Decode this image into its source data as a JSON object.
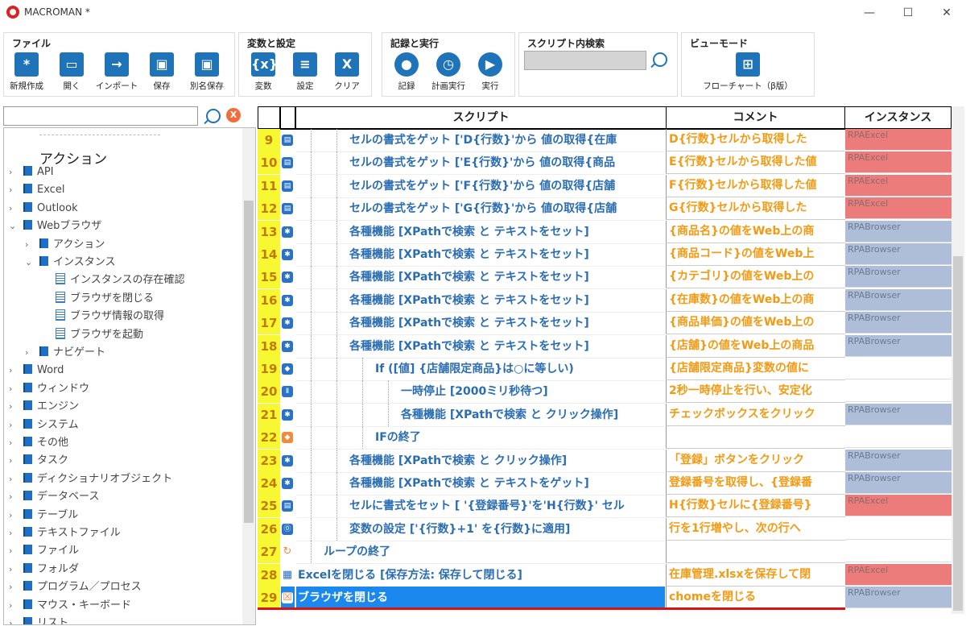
{
  "window": {
    "title": "MACROMAN *",
    "minimize": "—",
    "maximize": "☐",
    "close": "✕"
  },
  "ribbon": {
    "file": {
      "title": "ファイル",
      "buttons": [
        {
          "label": "新規作成",
          "icon": "*"
        },
        {
          "label": "開く",
          "icon": "▭"
        },
        {
          "label": "インポート",
          "icon": "→"
        },
        {
          "label": "保存",
          "icon": "▣"
        },
        {
          "label": "別名保存",
          "icon": "▣"
        }
      ]
    },
    "vars": {
      "title": "変数と設定",
      "buttons": [
        {
          "label": "変数",
          "icon": "{x}"
        },
        {
          "label": "設定",
          "icon": "≡"
        },
        {
          "label": "クリア",
          "icon": "X"
        }
      ]
    },
    "rec": {
      "title": "記録と実行",
      "buttons": [
        {
          "label": "記録",
          "icon": "●"
        },
        {
          "label": "計画実行",
          "icon": "◷"
        },
        {
          "label": "実行",
          "icon": "▶"
        }
      ]
    },
    "search": {
      "title": "スクリプト内検索",
      "value": ""
    },
    "view": {
      "title": "ビューモード",
      "buttons": [
        {
          "label": "フローチャート（β版）",
          "icon": "⊞"
        }
      ]
    }
  },
  "sidebar": {
    "search_value": "",
    "clear_label": "X",
    "heading": "アクション",
    "items": [
      {
        "label": "API",
        "arrow": "›",
        "type": "book",
        "indent": 0
      },
      {
        "label": "Excel",
        "arrow": "›",
        "type": "book",
        "indent": 0
      },
      {
        "label": "Outlook",
        "arrow": "›",
        "type": "book",
        "indent": 0
      },
      {
        "label": "Webブラウザ",
        "arrow": "⌄",
        "type": "book",
        "indent": 0
      },
      {
        "label": "アクション",
        "arrow": "›",
        "type": "book",
        "indent": 1
      },
      {
        "label": "インスタンス",
        "arrow": "⌄",
        "type": "book",
        "indent": 1
      },
      {
        "label": "インスタンスの存在確認",
        "arrow": "",
        "type": "doc",
        "indent": 2
      },
      {
        "label": "ブラウザを閉じる",
        "arrow": "",
        "type": "doc",
        "indent": 2
      },
      {
        "label": "ブラウザ情報の取得",
        "arrow": "",
        "type": "doc",
        "indent": 2
      },
      {
        "label": "ブラウザを起動",
        "arrow": "",
        "type": "doc",
        "indent": 2
      },
      {
        "label": "ナビゲート",
        "arrow": "›",
        "type": "book",
        "indent": 1
      },
      {
        "label": "Word",
        "arrow": "›",
        "type": "book",
        "indent": 0
      },
      {
        "label": "ウィンドウ",
        "arrow": "›",
        "type": "book",
        "indent": 0
      },
      {
        "label": "エンジン",
        "arrow": "›",
        "type": "book",
        "indent": 0
      },
      {
        "label": "システム",
        "arrow": "›",
        "type": "book",
        "indent": 0
      },
      {
        "label": "その他",
        "arrow": "›",
        "type": "book",
        "indent": 0
      },
      {
        "label": "タスク",
        "arrow": "›",
        "type": "book",
        "indent": 0
      },
      {
        "label": "ディクショナリオブジェクト",
        "arrow": "›",
        "type": "book",
        "indent": 0
      },
      {
        "label": "データベース",
        "arrow": "›",
        "type": "book",
        "indent": 0
      },
      {
        "label": "テーブル",
        "arrow": "›",
        "type": "book",
        "indent": 0
      },
      {
        "label": "テキストファイル",
        "arrow": "›",
        "type": "book",
        "indent": 0
      },
      {
        "label": "ファイル",
        "arrow": "›",
        "type": "book",
        "indent": 0
      },
      {
        "label": "フォルダ",
        "arrow": "›",
        "type": "book",
        "indent": 0
      },
      {
        "label": "プログラム／プロセス",
        "arrow": "›",
        "type": "book",
        "indent": 0
      },
      {
        "label": "マウス・キーボード",
        "arrow": "›",
        "type": "book",
        "indent": 0
      },
      {
        "label": "リスト",
        "arrow": "›",
        "type": "book",
        "indent": 0
      }
    ]
  },
  "grid": {
    "headers": {
      "script": "スクリプト",
      "comment": "コメント",
      "instance": "インスタンス"
    },
    "rows": [
      {
        "num": "9",
        "icon": "▤",
        "indent": 2,
        "script": "セルの書式をゲット ['D{行数}'から 値の取得{在庫",
        "comment": "D{行数}セルから取得した",
        "instance": "RPAExcel",
        "inst": "excel"
      },
      {
        "num": "10",
        "icon": "▤",
        "indent": 2,
        "script": "セルの書式をゲット ['E{行数}'から 値の取得{商品",
        "comment": "E{行数}セルから取得した値",
        "instance": "RPAExcel",
        "inst": "excel"
      },
      {
        "num": "11",
        "icon": "▤",
        "indent": 2,
        "script": "セルの書式をゲット ['F{行数}'から 値の取得{店舗",
        "comment": "F{行数}セルから取得した値",
        "instance": "RPAExcel",
        "inst": "excel"
      },
      {
        "num": "12",
        "icon": "▤",
        "indent": 2,
        "script": "セルの書式をゲット ['G{行数}'から 値の取得{店舗",
        "comment": "G{行数}セルから取得した",
        "instance": "RPAExcel",
        "inst": "excel"
      },
      {
        "num": "13",
        "icon": "✱",
        "indent": 2,
        "script": "各種機能 [XPathで検索 と テキストをセット]",
        "comment": "{商品名}の値をWeb上の商",
        "instance": "RPABrowser",
        "inst": "browser"
      },
      {
        "num": "14",
        "icon": "✱",
        "indent": 2,
        "script": "各種機能 [XPathで検索 と テキストをセット]",
        "comment": "{商品コード}の値をWeb上",
        "instance": "RPABrowser",
        "inst": "browser"
      },
      {
        "num": "15",
        "icon": "✱",
        "indent": 2,
        "script": "各種機能 [XPathで検索 と テキストをセット]",
        "comment": "{カテゴリ}の値をWeb上の",
        "instance": "RPABrowser",
        "inst": "browser"
      },
      {
        "num": "16",
        "icon": "✱",
        "indent": 2,
        "script": "各種機能 [XPathで検索 と テキストをセット]",
        "comment": "{在庫数}の値をWeb上の商",
        "instance": "RPABrowser",
        "inst": "browser"
      },
      {
        "num": "17",
        "icon": "✱",
        "indent": 2,
        "script": "各種機能 [XPathで検索 と テキストをセット]",
        "comment": "{商品単価}の値をWeb上の",
        "instance": "RPABrowser",
        "inst": "browser"
      },
      {
        "num": "18",
        "icon": "✱",
        "indent": 2,
        "script": "各種機能 [XPathで検索 と テキストをセット]",
        "comment": "{店舗}の値をWeb上の商品",
        "instance": "RPABrowser",
        "inst": "browser"
      },
      {
        "num": "19",
        "icon": "◆",
        "indent": 3,
        "script": "If ([値] {店舗限定商品}は○に等しい)",
        "comment": "{店舗限定商品}変数の値に",
        "instance": "",
        "inst": "none"
      },
      {
        "num": "20",
        "icon": "Ⅱ",
        "indent": 4,
        "script": "一時停止 [2000ミリ秒待つ]",
        "comment": "2秒一時停止を行い、安定化",
        "instance": "",
        "inst": "none"
      },
      {
        "num": "21",
        "icon": "✱",
        "indent": 4,
        "script": "各種機能 [XPathで検索 と クリック操作]",
        "comment": "チェックボックスをクリック",
        "instance": "RPABrowser",
        "inst": "browser"
      },
      {
        "num": "22",
        "icon": "◆",
        "indent": 3,
        "script": "IFの終了",
        "comment": "",
        "instance": "",
        "inst": "none"
      },
      {
        "num": "23",
        "icon": "✱",
        "indent": 2,
        "script": "各種機能 [XPathで検索 と クリック操作]",
        "comment": "「登録」ボタンをクリック",
        "instance": "RPABrowser",
        "inst": "browser"
      },
      {
        "num": "24",
        "icon": "✱",
        "indent": 2,
        "script": "各種機能 [XPathで検索 と テキストをゲット]",
        "comment": "登録番号を取得し、{登録番",
        "instance": "RPABrowser",
        "inst": "browser"
      },
      {
        "num": "25",
        "icon": "▤",
        "indent": 2,
        "script": "セルに書式をセット [ '{登録番号}'を'H{行数}' セル",
        "comment": "H{行数}セルに{登録番号}",
        "instance": "RPAExcel",
        "inst": "excel"
      },
      {
        "num": "26",
        "icon": "⓪",
        "indent": 2,
        "script": "変数の設定 ['{行数}+1' を{行数}に適用]",
        "comment": "行を1行増やし、次の行へ",
        "instance": "",
        "inst": "none"
      },
      {
        "num": "27",
        "icon": "↻",
        "indent": 1,
        "script": "ループの終了",
        "comment": "",
        "instance": "",
        "inst": "none"
      },
      {
        "num": "28",
        "icon": "▦",
        "indent": 0,
        "script": "Excelを閉じる [保存方法: 保存して閉じる]",
        "comment": "在庫管理.xlsxを保存して閉",
        "instance": "RPAExcel",
        "inst": "excel"
      },
      {
        "num": "29",
        "icon": "☒",
        "indent": 0,
        "script": "ブラウザを閉じる",
        "comment": "chomeを閉じる",
        "instance": "RPABrowser",
        "inst": "browser",
        "selected": true
      }
    ]
  }
}
